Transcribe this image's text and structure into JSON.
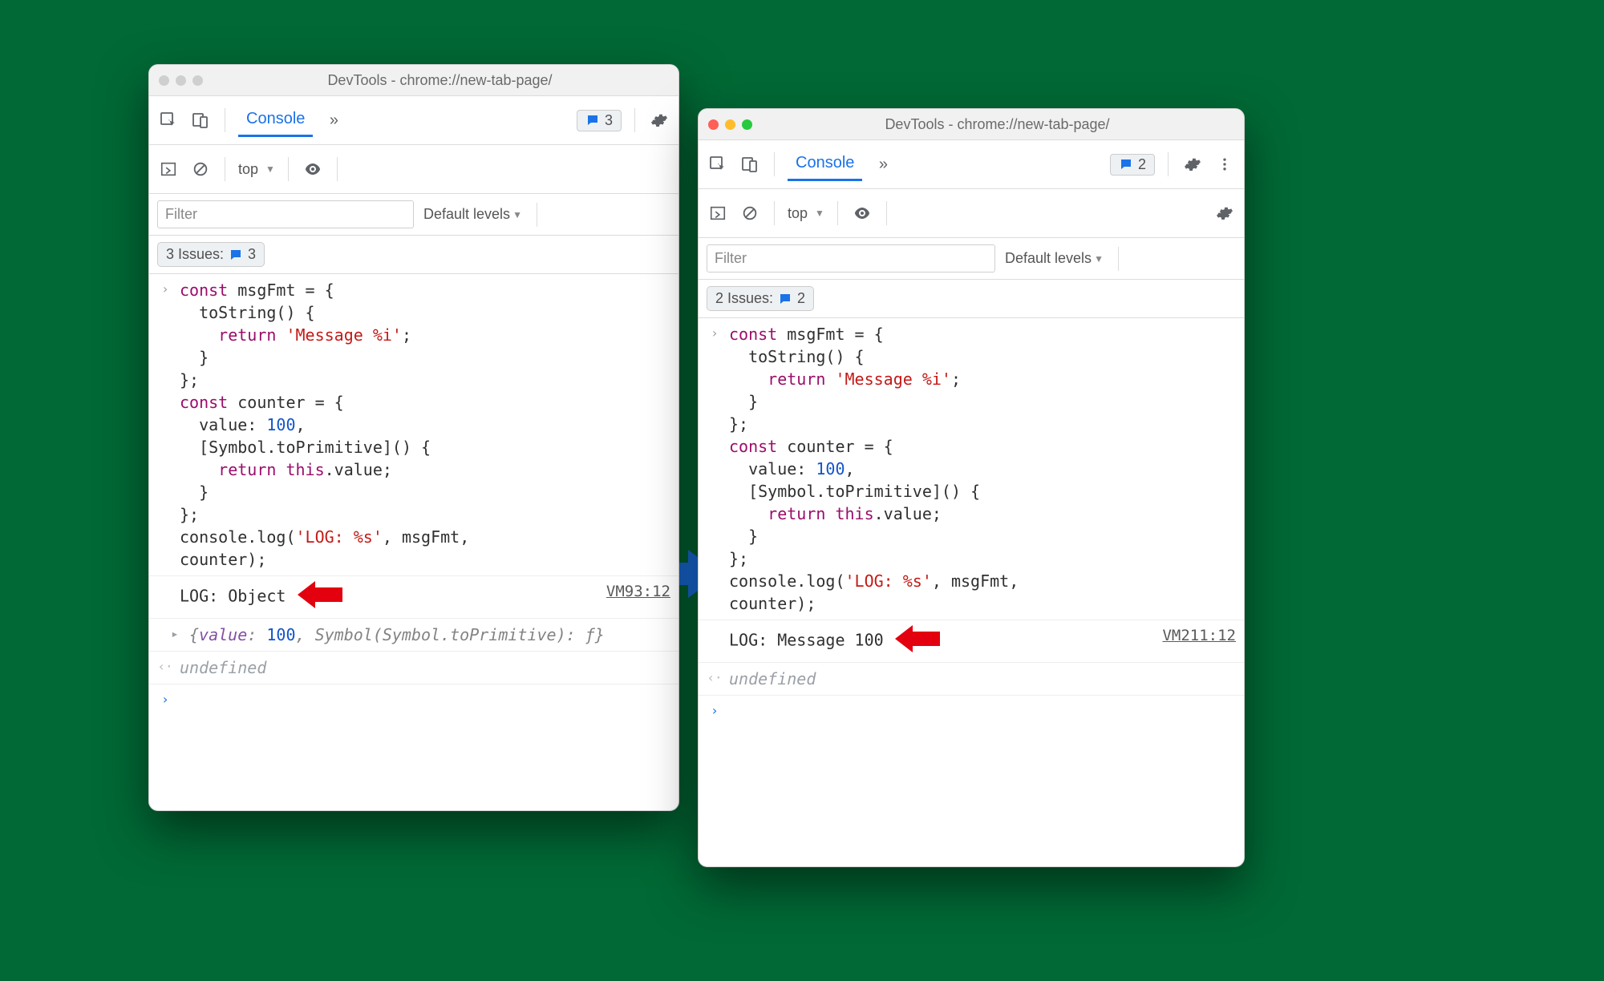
{
  "left": {
    "title": "DevTools - chrome://new-tab-page/",
    "tab": "Console",
    "badgeCount": "3",
    "context": "top",
    "filterPlaceholder": "Filter",
    "levels": "Default levels",
    "issuesLabel": "3 Issues:",
    "issuesCount": "3",
    "logOutput": "LOG: Object",
    "sourceLink": "VM93:12",
    "expandValueLabel": "value",
    "expandValueNum": "100",
    "expandRest": ", Symbol(Symbol.toPrimitive): ƒ}",
    "undefined": "undefined"
  },
  "right": {
    "title": "DevTools - chrome://new-tab-page/",
    "tab": "Console",
    "badgeCount": "2",
    "context": "top",
    "filterPlaceholder": "Filter",
    "levels": "Default levels",
    "issuesLabel": "2 Issues:",
    "issuesCount": "2",
    "logOutput": "LOG: Message 100",
    "sourceLink": "VM211:12",
    "undefined": "undefined"
  },
  "code": {
    "l1_a": "const",
    "l1_b": " msgFmt = {",
    "l2": "  toString() {",
    "l3_a": "    ",
    "l3_b": "return",
    "l3_c": " ",
    "l3_d": "'Message %i'",
    "l3_e": ";",
    "l4": "  }",
    "l5": "};",
    "l6_a": "const",
    "l6_b": " counter = {",
    "l7_a": "  value: ",
    "l7_b": "100",
    "l7_c": ",",
    "l8": "  [Symbol.toPrimitive]() {",
    "l9_a": "    ",
    "l9_b": "return",
    "l9_c": " ",
    "l9_d": "this",
    "l9_e": ".value;",
    "l10": "  }",
    "l11": "};",
    "l12_a": "console.log(",
    "l12_b": "'LOG: %s'",
    "l12_c": ", msgFmt,",
    "l13": "counter);"
  }
}
